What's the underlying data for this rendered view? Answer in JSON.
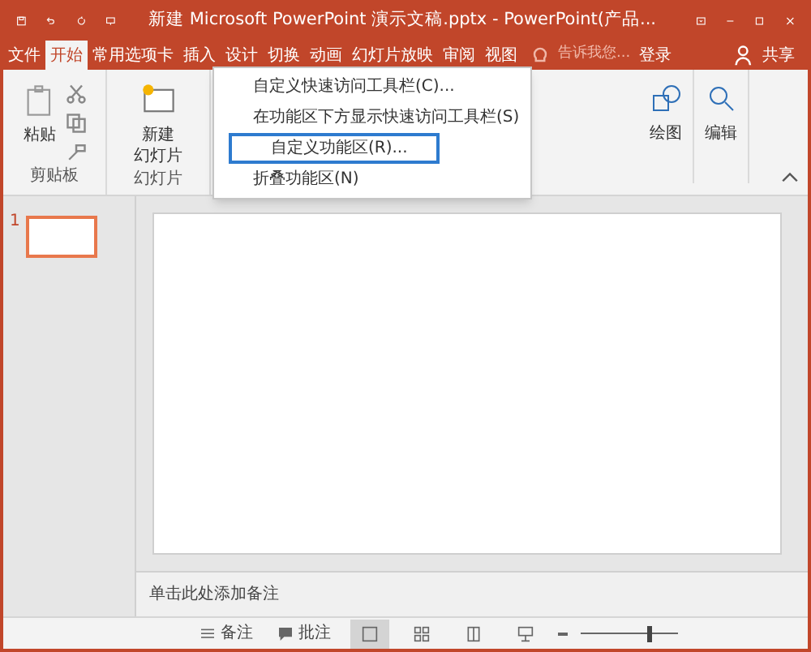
{
  "window": {
    "title": "新建 Microsoft PowerPoint 演示文稿.pptx - PowerPoint(产品..."
  },
  "tabs": [
    {
      "label": "文件",
      "selected": false
    },
    {
      "label": "开始",
      "selected": true
    },
    {
      "label": "常用选项卡",
      "selected": false
    },
    {
      "label": "插入",
      "selected": false
    },
    {
      "label": "设计",
      "selected": false
    },
    {
      "label": "切换",
      "selected": false
    },
    {
      "label": "动画",
      "selected": false
    },
    {
      "label": "幻灯片放映",
      "selected": false
    },
    {
      "label": "审阅",
      "selected": false
    },
    {
      "label": "视图",
      "selected": false
    }
  ],
  "tell_me": {
    "placeholder": "告诉我您..."
  },
  "account": {
    "login": "登录",
    "share": "共享"
  },
  "ribbon": {
    "groups": [
      {
        "label": "剪贴板",
        "button": [
          "粘贴"
        ]
      },
      {
        "label": "幻灯片",
        "button": [
          "新建",
          "幻灯片"
        ]
      }
    ],
    "right_buttons": [
      "绘图",
      "编辑"
    ]
  },
  "context_menu": [
    {
      "label": "自定义快速访问工具栏(C)...",
      "selected": false
    },
    {
      "label": "在功能区下方显示快速访问工具栏(S)",
      "selected": false
    },
    {
      "label": "自定义功能区(R)...",
      "selected": true
    },
    {
      "label": "折叠功能区(N)",
      "selected": false
    }
  ],
  "thumbnails": [
    {
      "number": "1",
      "selected": true
    }
  ],
  "notes": {
    "placeholder": "单击此处添加备注"
  },
  "status_bar": {
    "buttons": [
      "备注",
      "批注"
    ],
    "views": [
      {
        "selected": true
      },
      {
        "selected": false
      },
      {
        "selected": false
      },
      {
        "selected": false
      }
    ],
    "zoom": {
      "level": 0.7
    }
  }
}
